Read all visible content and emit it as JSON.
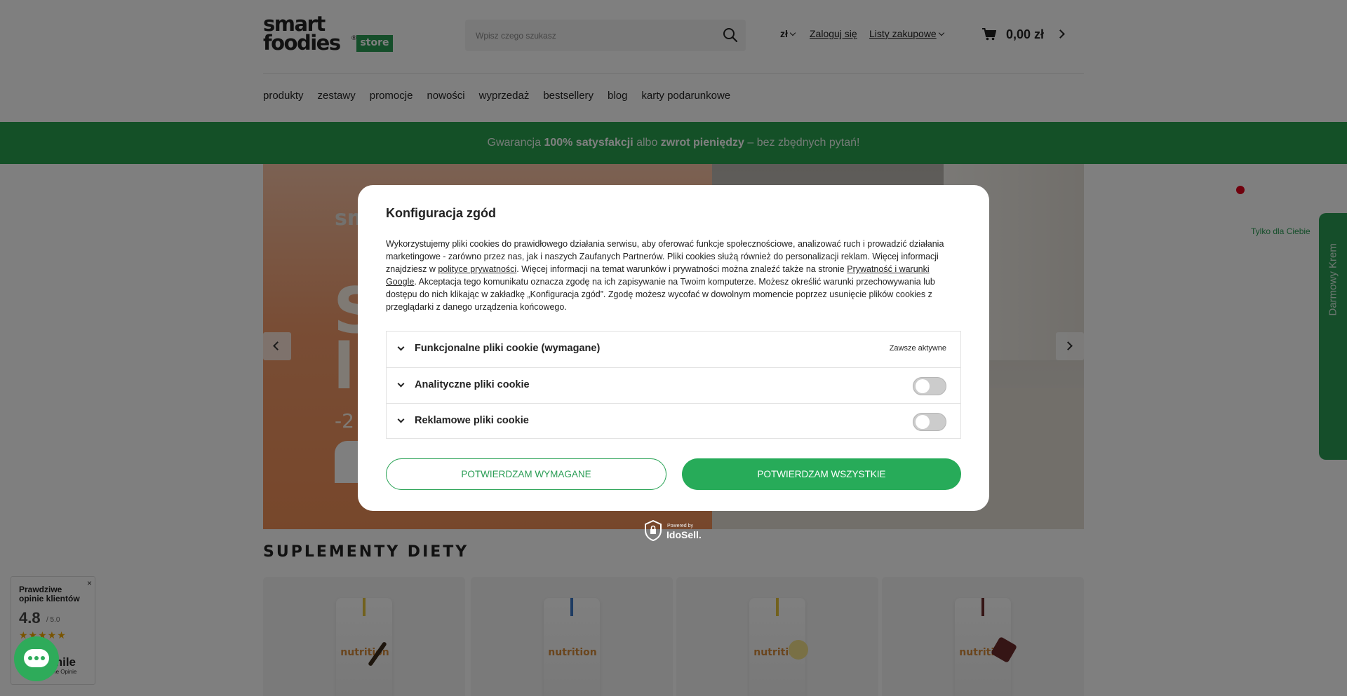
{
  "header": {
    "logo": {
      "line1": "smart",
      "line2": "foodies",
      "reg": "®",
      "badge": "store"
    },
    "search": {
      "placeholder": "Wpisz czego szukasz",
      "icon": "search-icon"
    },
    "currency": "zł",
    "login": "Zaloguj się",
    "lists": "Listy zakupowe",
    "cart": {
      "price": "0,00 zł",
      "icon": "cart-icon"
    },
    "nav": [
      "produkty",
      "zestawy",
      "promocje",
      "nowości",
      "wyprzedaż",
      "bestsellery",
      "blog",
      "karty podarunkowe"
    ]
  },
  "promo": {
    "p1": "Gwarancja ",
    "b1": "100% satysfakcji",
    "p2": " albo ",
    "b2": "zwrot pieniędzy",
    "p3": " – bez zbędnych pytań!"
  },
  "hero": {
    "brand_partial": "sm",
    "big_partial_1": "S",
    "big_partial_2": "l",
    "discount_partial": "-2"
  },
  "section": {
    "title": "SUPLEMENTY DIETY"
  },
  "products": [
    {
      "brand": "nutrition",
      "accent": "#e5c23a",
      "deco": "#3a2a1a"
    },
    {
      "brand": "nutrition",
      "accent": "#3a77c4",
      "deco": "#ffffff"
    },
    {
      "brand": "nutrition",
      "accent": "#e5c23a",
      "deco": "#f2e08a"
    },
    {
      "brand": "nutrition",
      "accent": "#6b2a2a",
      "deco": "#6b2a2a"
    }
  ],
  "reviews": {
    "title": "Prawdziwe opinie klientów",
    "score": "4.8",
    "of": "/ 5.0",
    "stars": "★★★★★",
    "brand": "mile",
    "sub": "rane Opinie",
    "close": "×"
  },
  "side": {
    "circle_label": "Tylko dla Ciebie",
    "tab_label": "Darmowy Krem"
  },
  "consent": {
    "title": "Konfiguracja zgód",
    "desc_1": "Wykorzystujemy pliki cookies do prawidłowego działania serwisu, aby oferować funkcje społecznościowe, analizować ruch i prowadzić działania marketingowe - zarówno przez nas, jak i naszych Zaufanych Partnerów. Pliki cookies służą również do personalizacji reklam. Więcej informacji znajdziesz w ",
    "link_1": "polityce prywatności",
    "desc_2": ". Więcej informacji na temat warunków i prywatności można znaleźć także na stronie ",
    "link_2": "Prywatność i warunki Google",
    "desc_3": ". Akceptacja tego komunikatu oznacza zgodę na ich zapisywanie na Twoim komputerze. Możesz określić warunki przechowywania lub dostępu do nich klikając w zakładkę „Konfiguracja zgód”. Zgodę możesz wycofać w dowolnym momencie poprzez usunięcie plików cookies z przeglądarki z danego urządzenia końcowego.",
    "rows": [
      {
        "label": "Funkcjonalne pliki cookie (wymagane)",
        "status": "Zawsze aktywne"
      },
      {
        "label": "Analityczne pliki cookie",
        "enabled": false
      },
      {
        "label": "Reklamowe pliki cookie",
        "enabled": false
      }
    ],
    "btn_required": "POTWIERDZAM WYMAGANE",
    "btn_all": "POTWIERDZAM WSZYSTKIE",
    "powered_by": "Powered by",
    "provider": "IdoSell."
  },
  "colors": {
    "brand_green": "#2a9d55",
    "button_green": "#27ab59",
    "hero_orange": "#ef8f57"
  }
}
